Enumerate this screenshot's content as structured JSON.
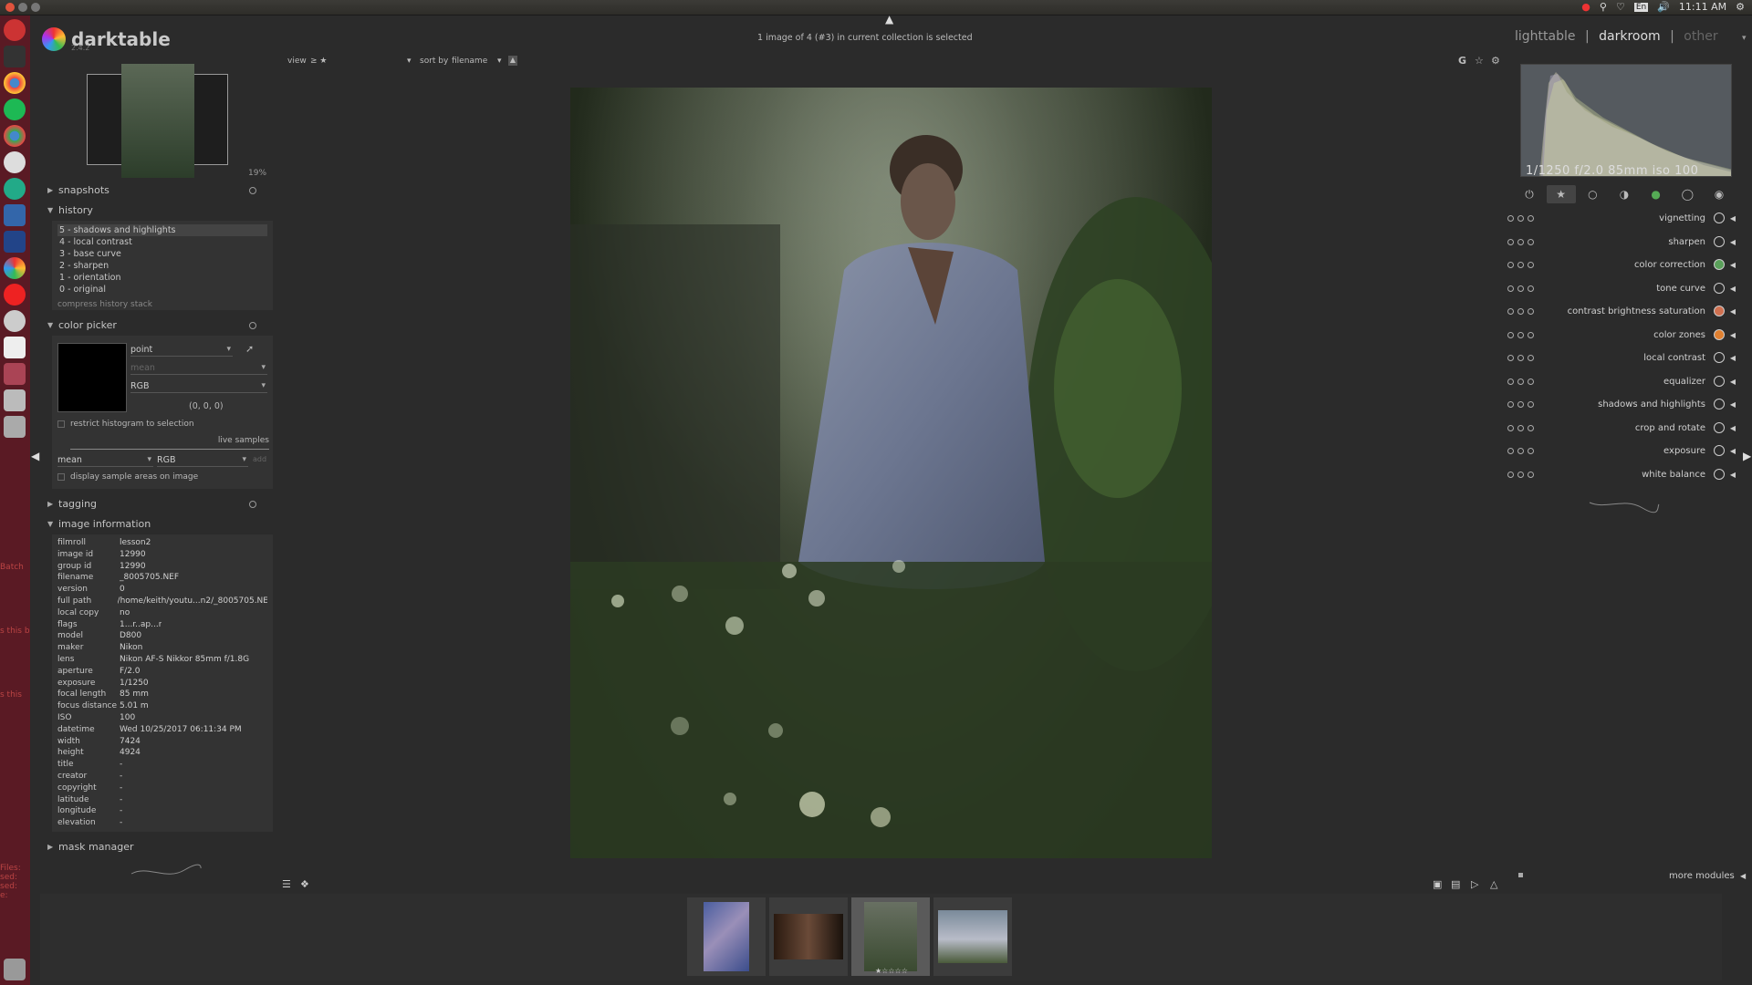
{
  "system": {
    "time": "11:11 AM",
    "keyboard": "En"
  },
  "app": {
    "name": "darktable",
    "version": "2.4.2"
  },
  "navigation": {
    "zoom": "19%"
  },
  "header": {
    "status": "1 image of 4 (#3) in current collection is selected",
    "view_label": "view",
    "view_value": "≥ ★",
    "sort_label": "sort by",
    "sort_value": "filename"
  },
  "views": {
    "lighttable": "lighttable",
    "separator": "|",
    "darkroom": "darkroom",
    "other": "other"
  },
  "histogram": {
    "exif": "1/1250 f/2.0 85mm iso 100"
  },
  "left": {
    "snapshots": "snapshots",
    "history_title": "history",
    "history": [
      {
        "label": "5 - shadows and highlights"
      },
      {
        "label": "4 - local contrast"
      },
      {
        "label": "3 - base curve"
      },
      {
        "label": "2 - sharpen"
      },
      {
        "label": "1 - orientation"
      },
      {
        "label": "0 - original"
      }
    ],
    "compress": "compress history stack",
    "color_picker_title": "color picker",
    "picker_mode": "point",
    "picker_stat": "mean",
    "picker_space": "RGB",
    "picker_value": "(0, 0, 0)",
    "restrict": "restrict histogram to selection",
    "live_samples": "live samples",
    "sample_stat": "mean",
    "sample_space": "RGB",
    "add": "add",
    "display_samples": "display sample areas on image",
    "tagging": "tagging",
    "image_info_title": "image information",
    "mask_manager": "mask manager"
  },
  "image_info": [
    {
      "k": "filmroll",
      "v": "lesson2"
    },
    {
      "k": "image id",
      "v": "12990"
    },
    {
      "k": "group id",
      "v": "12990"
    },
    {
      "k": "filename",
      "v": "_8005705.NEF"
    },
    {
      "k": "version",
      "v": "0"
    },
    {
      "k": "full path",
      "v": "/home/keith/youtu...n2/_8005705.NEF"
    },
    {
      "k": "local copy",
      "v": "no"
    },
    {
      "k": "flags",
      "v": "1...r..ap...r"
    },
    {
      "k": "model",
      "v": "D800"
    },
    {
      "k": "maker",
      "v": "Nikon"
    },
    {
      "k": "lens",
      "v": "Nikon AF-S Nikkor 85mm f/1.8G"
    },
    {
      "k": "aperture",
      "v": "F/2.0"
    },
    {
      "k": "exposure",
      "v": "1/1250"
    },
    {
      "k": "focal length",
      "v": "85 mm"
    },
    {
      "k": "focus distance",
      "v": "5.01 m"
    },
    {
      "k": "ISO",
      "v": "100"
    },
    {
      "k": "datetime",
      "v": "Wed 10/25/2017 06:11:34 PM"
    },
    {
      "k": "width",
      "v": "7424"
    },
    {
      "k": "height",
      "v": "4924"
    },
    {
      "k": "title",
      "v": "-"
    },
    {
      "k": "creator",
      "v": "-"
    },
    {
      "k": "copyright",
      "v": "-"
    },
    {
      "k": "latitude",
      "v": "-"
    },
    {
      "k": "longitude",
      "v": "-"
    },
    {
      "k": "elevation",
      "v": "-"
    }
  ],
  "modules": [
    {
      "name": "vignetting",
      "color": "#cccccc"
    },
    {
      "name": "sharpen",
      "color": "#cccccc"
    },
    {
      "name": "color correction",
      "color": "#5aa05a"
    },
    {
      "name": "tone curve",
      "color": "#cccccc"
    },
    {
      "name": "contrast brightness saturation",
      "color": "#d07050"
    },
    {
      "name": "color zones",
      "color": "#e08030"
    },
    {
      "name": "local contrast",
      "color": "#cccccc"
    },
    {
      "name": "equalizer",
      "color": "#cccccc"
    },
    {
      "name": "shadows and highlights",
      "color": "#cccccc"
    },
    {
      "name": "crop and rotate",
      "color": "#cccccc"
    },
    {
      "name": "exposure",
      "color": "#cccccc"
    },
    {
      "name": "white balance",
      "color": "#cccccc"
    }
  ],
  "more_modules": "more modules",
  "launcher_text": [
    "Batch",
    "s this b",
    "s this",
    "Files:",
    "sed:",
    "sed:",
    "e:"
  ]
}
